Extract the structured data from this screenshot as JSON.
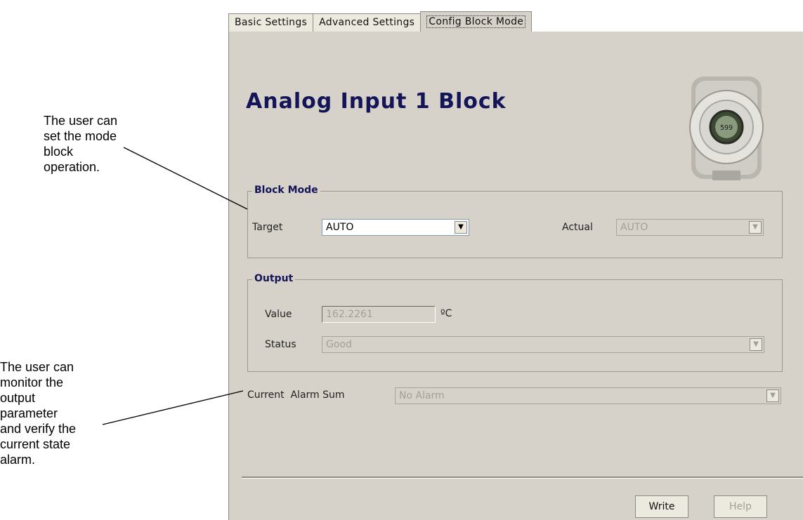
{
  "annotations": [
    "The user can\nset the mode\nblock\noperation.",
    "The user can\nmonitor the\noutput\nparameter\nand verify the\ncurrent state\nalarm."
  ],
  "tabs": [
    {
      "label": "Basic Settings"
    },
    {
      "label": "Advanced Settings"
    },
    {
      "label": "Config Block Mode",
      "active": true
    }
  ],
  "page_title": "Analog Input 1 Block",
  "device_display": "599",
  "block_mode": {
    "legend": "Block Mode",
    "target_label": "Target",
    "target_value": "AUTO",
    "actual_label": "Actual",
    "actual_value": "AUTO"
  },
  "output": {
    "legend": "Output",
    "value_label": "Value",
    "value": "162.2261",
    "unit": "ºC",
    "status_label": "Status",
    "status": "Good"
  },
  "alarm": {
    "label": "Current  Alarm Sum",
    "value": "No Alarm"
  },
  "buttons": {
    "write": "Write",
    "help": "Help"
  },
  "colors": {
    "panel": "#d6d2c9",
    "title": "#141459"
  }
}
